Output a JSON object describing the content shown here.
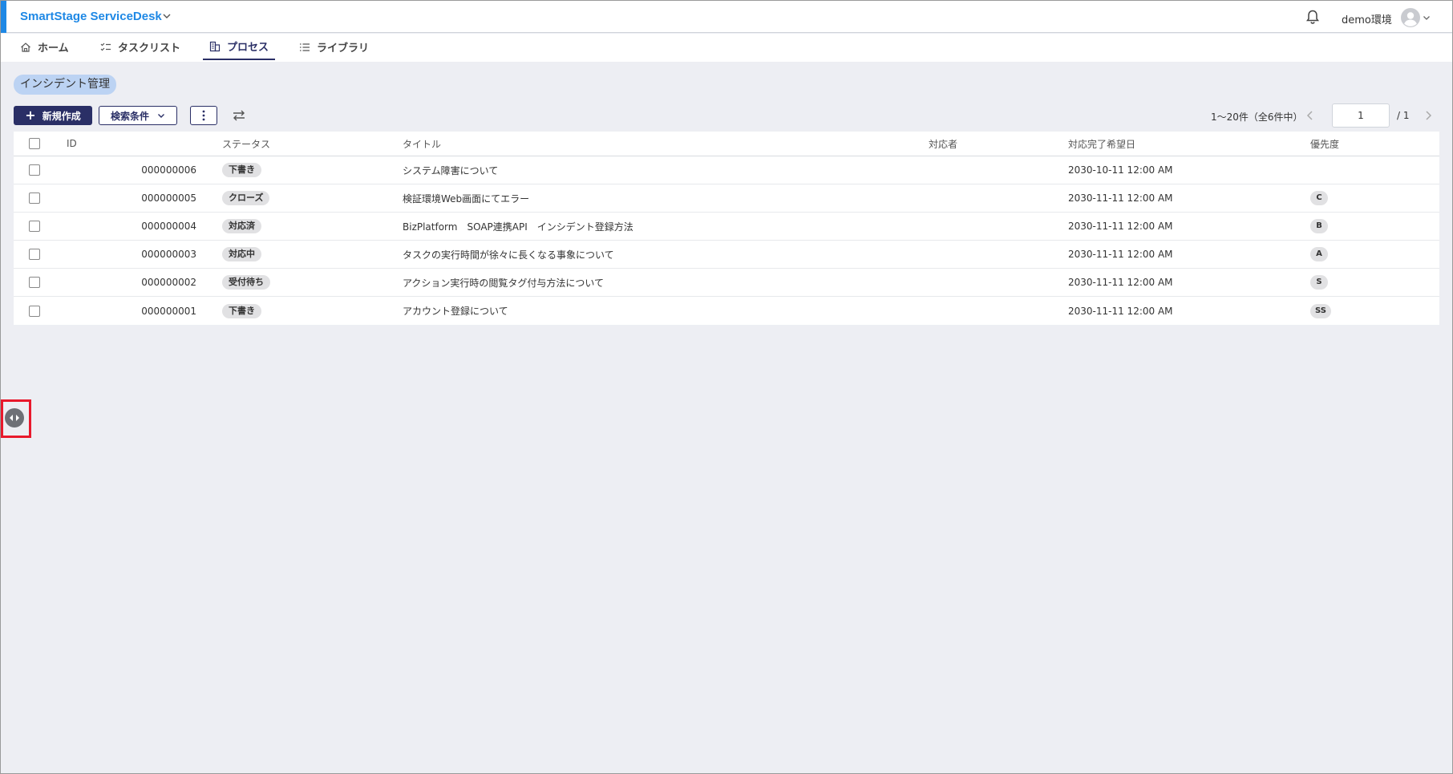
{
  "header": {
    "app_title": "SmartStage ServiceDesk",
    "user_name": "demo環境",
    "accent_color": "#1e88e5"
  },
  "nav": {
    "tabs": [
      {
        "label": "ホーム",
        "icon": "home-icon"
      },
      {
        "label": "タスクリスト",
        "icon": "tasklist-icon"
      },
      {
        "label": "プロセス",
        "icon": "process-icon",
        "active": true
      },
      {
        "label": "ライブラリ",
        "icon": "library-icon"
      }
    ]
  },
  "page": {
    "breadcrumb": "インシデント管理",
    "new_button": "新規作成",
    "search_button": "検索条件",
    "pagination": {
      "summary": "1〜20件（全6件中）",
      "page": "1",
      "total": "/ 1"
    }
  },
  "table": {
    "headers": {
      "id": "ID",
      "status": "ステータス",
      "title": "タイトル",
      "assignee": "対応者",
      "due": "対応完了希望日",
      "priority": "優先度"
    },
    "rows": [
      {
        "id": "000000006",
        "status": "下書き",
        "title": "システム障害について",
        "assignee": "",
        "due": "2030-10-11 12:00 AM",
        "priority": ""
      },
      {
        "id": "000000005",
        "status": "クローズ",
        "title": "検証環境Web画面にてエラー",
        "assignee": "",
        "due": "2030-11-11 12:00 AM",
        "priority": "C"
      },
      {
        "id": "000000004",
        "status": "対応済",
        "title": "BizPlatform　SOAP連携API　インシデント登録方法",
        "assignee": "",
        "due": "2030-11-11 12:00 AM",
        "priority": "B"
      },
      {
        "id": "000000003",
        "status": "対応中",
        "title": "タスクの実行時間が徐々に長くなる事象について",
        "assignee": "",
        "due": "2030-11-11 12:00 AM",
        "priority": "A"
      },
      {
        "id": "000000002",
        "status": "受付待ち",
        "title": "アクション実行時の閲覧タグ付与方法について",
        "assignee": "",
        "due": "2030-11-11 12:00 AM",
        "priority": "S"
      },
      {
        "id": "000000001",
        "status": "下書き",
        "title": "アカウント登録について",
        "assignee": "",
        "due": "2030-11-11 12:00 AM",
        "priority": "SS"
      }
    ]
  }
}
